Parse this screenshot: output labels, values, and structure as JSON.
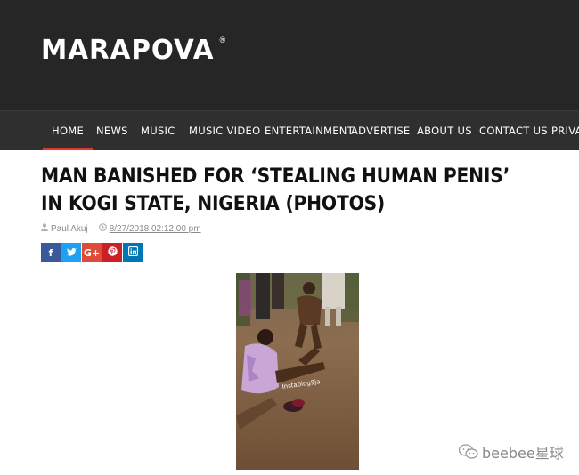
{
  "header": {
    "logo_text": "MARAPOVA",
    "logo_mark": "®"
  },
  "nav": {
    "items": [
      "HOME",
      "NEWS",
      "MUSIC",
      "MUSIC VIDEO",
      "ENTERTAINMENT",
      "ADVERTISE",
      "ABOUT US",
      "CONTACT US",
      "PRIVAC"
    ],
    "active": "HOME",
    "accent_color": "#e03a2f"
  },
  "article": {
    "title": "MAN BANISHED FOR ‘STEALING HUMAN PENIS’ IN KOGI STATE, NIGERIA (PHOTOS)",
    "author": "Paul Akuj",
    "date": "8/27/2018 02:12:00 pm",
    "photo_watermark": "Instablog9ja"
  },
  "share": [
    {
      "label": "f",
      "icon": "facebook-icon",
      "color": "#3b5998"
    },
    {
      "label": "t",
      "icon": "twitter-icon",
      "color": "#1da1f2"
    },
    {
      "label": "G+",
      "icon": "google-plus-icon",
      "color": "#dd4b39"
    },
    {
      "label": "p",
      "icon": "pinterest-icon",
      "color": "#cb2027"
    },
    {
      "label": "in",
      "icon": "linkedin-icon",
      "color": "#0077b5"
    }
  ],
  "watermark": {
    "text": "beebee星球"
  }
}
